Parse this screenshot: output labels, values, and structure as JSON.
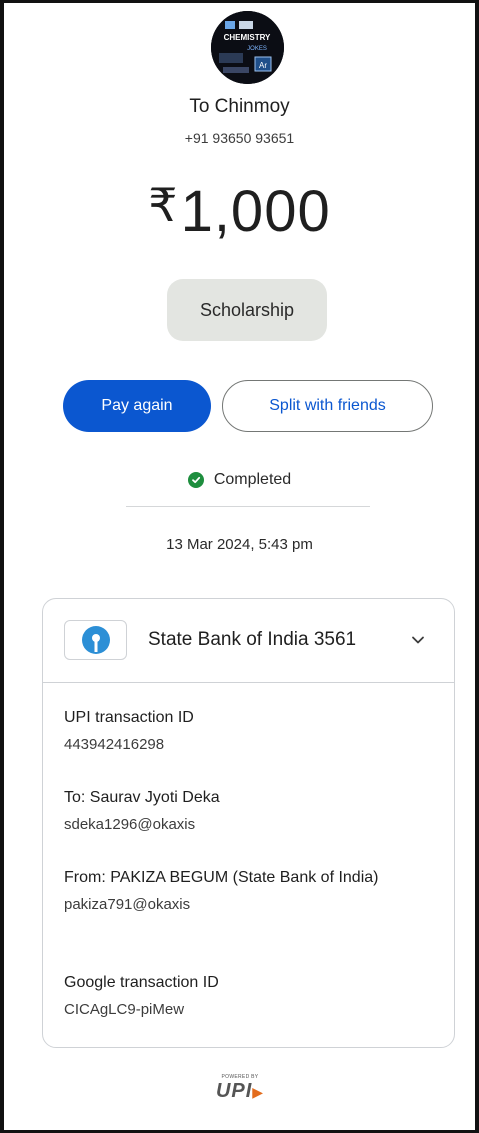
{
  "payee": {
    "avatar_text": [
      "CHEMISTRY",
      "JOKES",
      "Ar"
    ],
    "to_label": "To Chinmoy",
    "phone": "+91 93650 93651"
  },
  "amount": {
    "currency": "₹",
    "value": "1,000"
  },
  "note": "Scholarship",
  "actions": {
    "pay_again": "Pay again",
    "split": "Split with friends"
  },
  "status": {
    "label": "Completed",
    "color": "#1e8e3e"
  },
  "datetime": "13 Mar 2024, 5:43 pm",
  "bank": {
    "name": "State Bank of India 3561",
    "logo_color": "#2c8fd6"
  },
  "details": [
    {
      "label": "UPI transaction ID",
      "value": "443942416298"
    },
    {
      "label": "To: Saurav Jyoti Deka",
      "value": "sdeka1296@okaxis"
    },
    {
      "label": "From: PAKIZA  BEGUM (State Bank of India)",
      "value": "pakiza791@okaxis"
    },
    {
      "label": "Google transaction ID",
      "value": "CICAgLC9-piMew"
    }
  ],
  "footer": {
    "powered": "POWERED BY",
    "brand": "UPI"
  },
  "colors": {
    "primary": "#0b57d0",
    "chip": "#e3e5e1"
  }
}
